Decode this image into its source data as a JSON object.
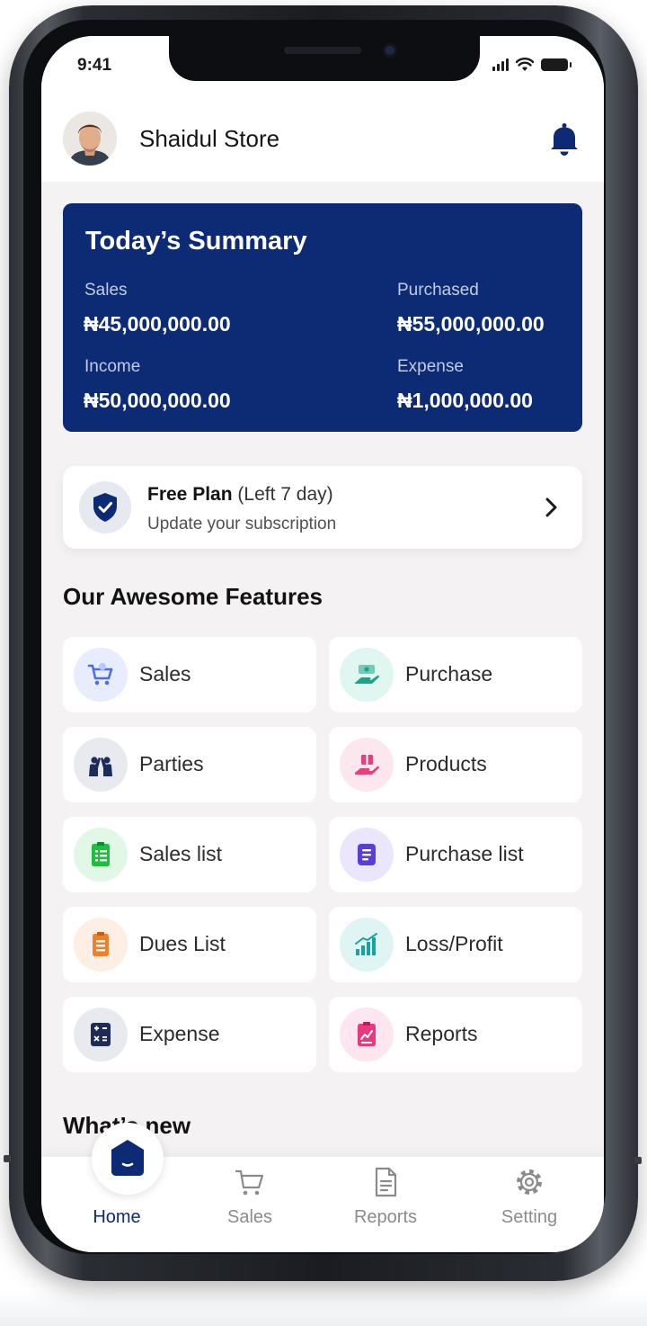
{
  "status_bar": {
    "time": "9:41"
  },
  "header": {
    "store_name": "Shaidul Store"
  },
  "summary": {
    "title": "Today’s Summary",
    "items": [
      {
        "label": "Sales",
        "value": "₦45,000,000.00"
      },
      {
        "label": "Purchased",
        "value": "₦55,000,000.00"
      },
      {
        "label": "Income",
        "value": "₦50,000,000.00"
      },
      {
        "label": "Expense",
        "value": "₦1,000,000.00"
      }
    ]
  },
  "plan": {
    "title": "Free Plan",
    "note": "(Left 7 day)",
    "subtitle": "Update your subscription"
  },
  "features": {
    "title": "Our Awesome Features",
    "items": [
      {
        "label": "Sales",
        "icon": "shopping-cart-icon",
        "color": "#4f6fe0",
        "bg": "#e7edff"
      },
      {
        "label": "Purchase",
        "icon": "money-hand-icon",
        "color": "#1aa58a",
        "bg": "#e0f6f1"
      },
      {
        "label": "Parties",
        "icon": "people-icon",
        "color": "#1c2b5a",
        "bg": "#e8eaf0"
      },
      {
        "label": "Products",
        "icon": "gift-hand-icon",
        "color": "#e8407e",
        "bg": "#fde7ef"
      },
      {
        "label": "Sales list",
        "icon": "clipboard-list-icon",
        "color": "#1fbe3f",
        "bg": "#e2f8e6"
      },
      {
        "label": "Purchase list",
        "icon": "document-list-icon",
        "color": "#5b3ed6",
        "bg": "#ebe6fb"
      },
      {
        "label": "Dues List",
        "icon": "clipboard-dues-icon",
        "color": "#f07f2e",
        "bg": "#fdefe3"
      },
      {
        "label": "Loss/Profit",
        "icon": "growth-chart-icon",
        "color": "#17a3a1",
        "bg": "#dff5f4"
      },
      {
        "label": "Expense",
        "icon": "calculator-icon",
        "color": "#1c2b5a",
        "bg": "#e8eaf0"
      },
      {
        "label": "Reports",
        "icon": "report-clipboard-icon",
        "color": "#e83a7e",
        "bg": "#fde6ef"
      }
    ]
  },
  "whats_new": {
    "title": "What’s new"
  },
  "nav": {
    "items": [
      {
        "label": "Home",
        "icon": "home-icon",
        "active": true
      },
      {
        "label": "Sales",
        "icon": "cart-icon",
        "active": false
      },
      {
        "label": "Reports",
        "icon": "document-icon",
        "active": false
      },
      {
        "label": "Setting",
        "icon": "gear-icon",
        "active": false
      }
    ]
  },
  "colors": {
    "primary": "#0d2b74",
    "background": "#f4f2f2",
    "card": "#ffffff"
  }
}
